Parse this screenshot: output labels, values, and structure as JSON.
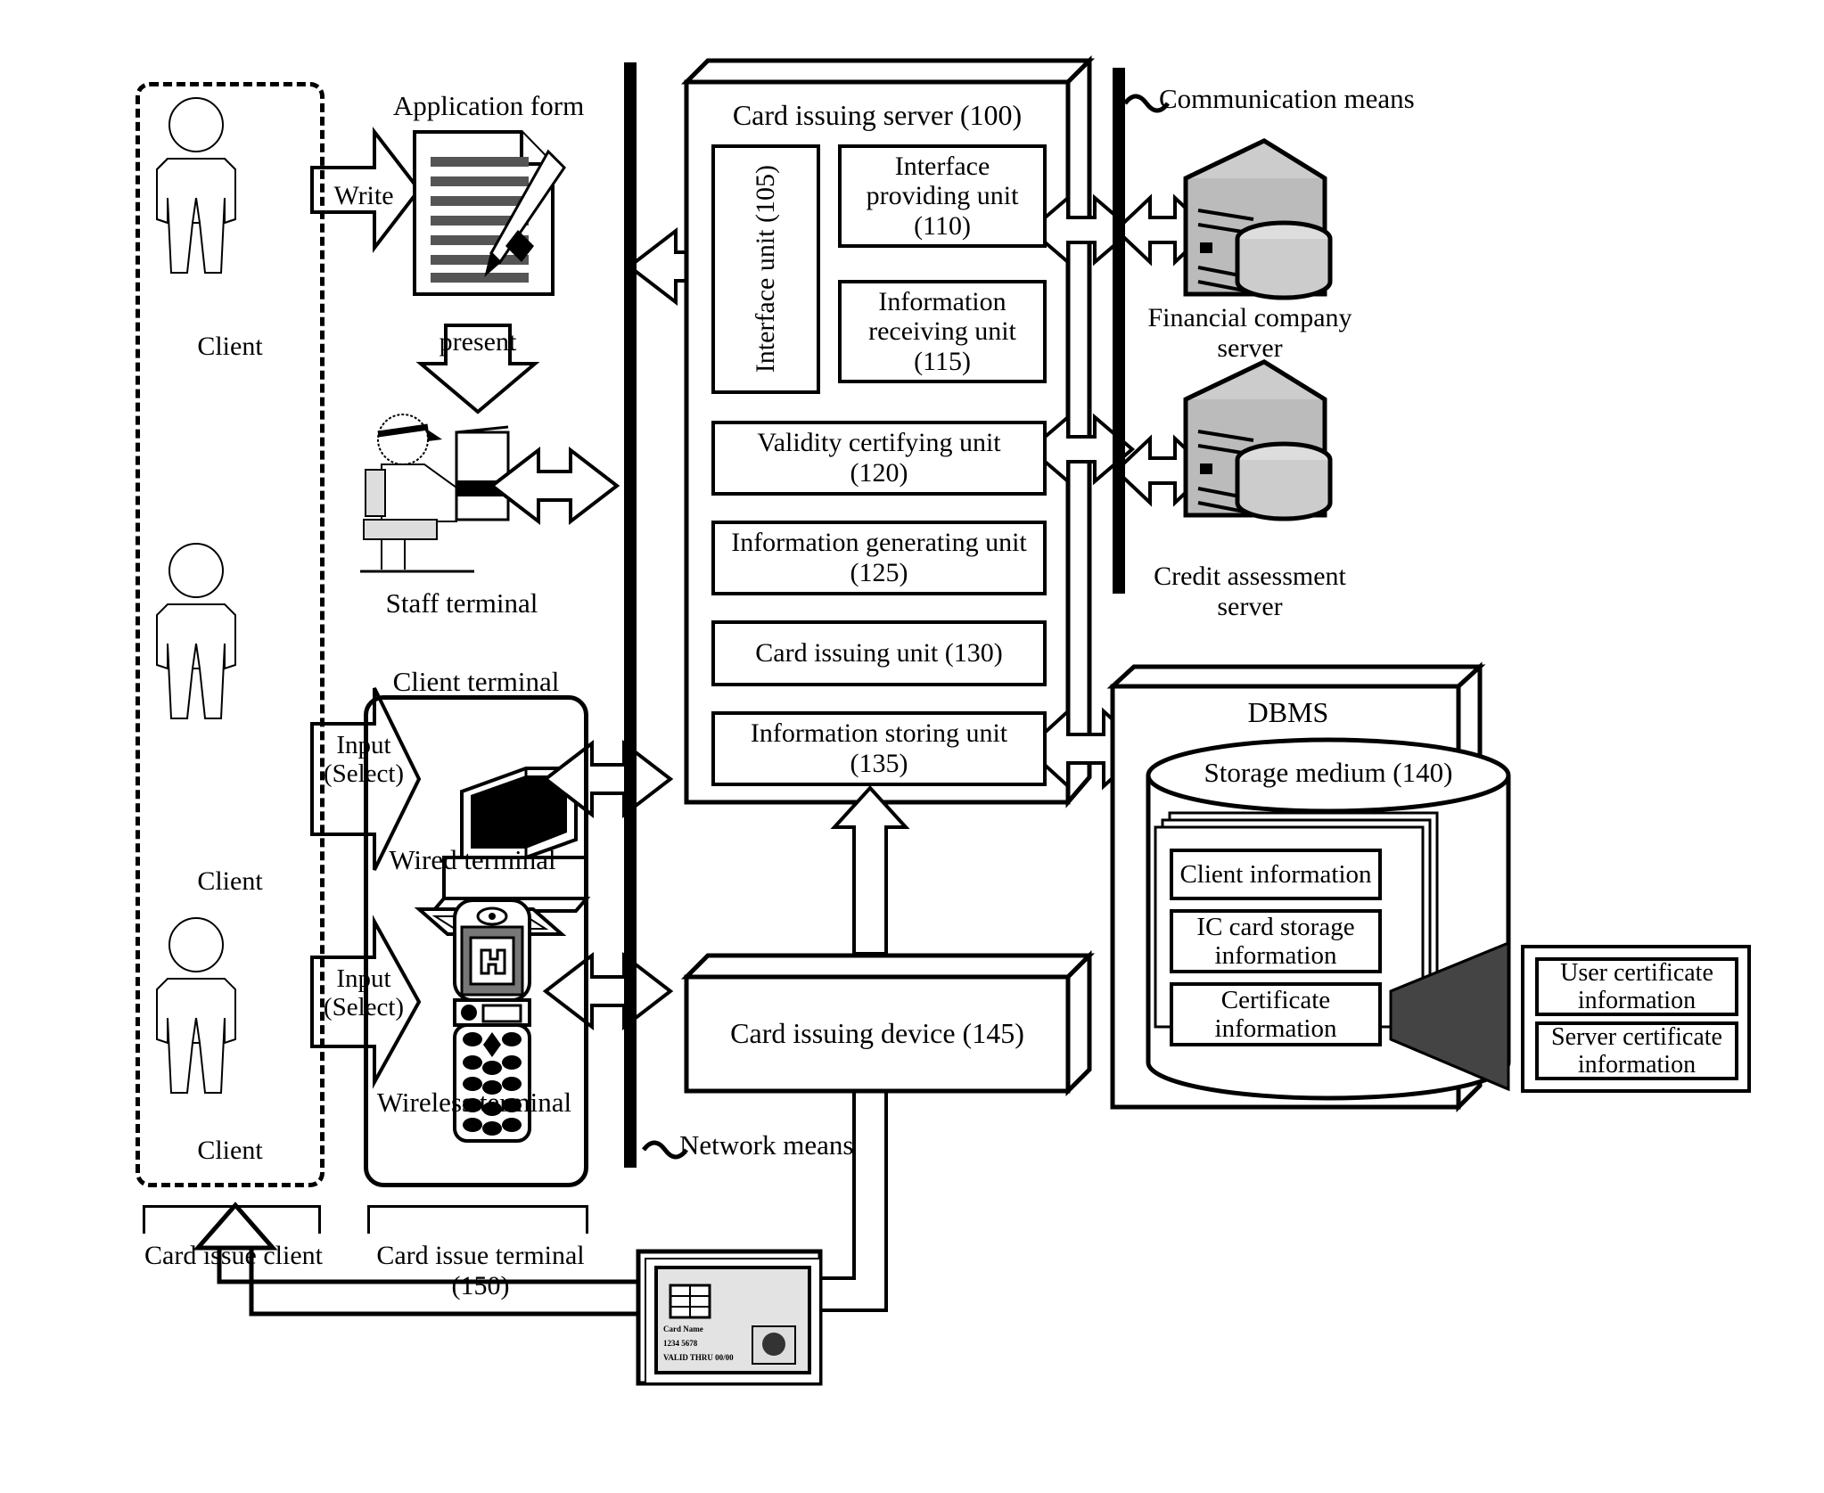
{
  "figure": {
    "type": "patent-block-diagram",
    "title": "Card issuing system block diagram"
  },
  "left": {
    "client_label_1": "Client",
    "client_label_2": "Client",
    "client_label_3": "Client",
    "application_form": "Application form",
    "write_arrow": "Write",
    "present_arrow": "present",
    "staff_terminal": "Staff terminal",
    "client_terminal": "Client terminal",
    "wired_terminal": "Wired terminal",
    "wireless_terminal": "Wireless terminal",
    "input_select_1": "Input\n(Select)",
    "input_select_2": "Input\n(Select)",
    "card_issue_client": "Card issue client",
    "card_issue_terminal": "Card issue terminal\n(150)"
  },
  "network": {
    "network_means": "Network means",
    "communication_means": "Communication means"
  },
  "server": {
    "title": "Card issuing server (100)",
    "interface_unit": "Interface unit\n(105)",
    "units": [
      {
        "label": "Interface\nproviding unit\n(110)",
        "id": "110"
      },
      {
        "label": "Information\nreceiving unit\n(115)",
        "id": "115"
      },
      {
        "label": "Validity certifying unit\n(120)",
        "id": "120"
      },
      {
        "label": "Information generating unit\n(125)",
        "id": "125"
      },
      {
        "label": "Card issuing unit (130)",
        "id": "130"
      },
      {
        "label": "Information storing unit\n(135)",
        "id": "135"
      }
    ]
  },
  "external": {
    "financial_server": "Financial company\nserver",
    "credit_server": "Credit assessment\nserver"
  },
  "dbms": {
    "title": "DBMS",
    "storage_medium": "Storage medium (140)",
    "records": [
      "Client information",
      "IC card storage\ninformation",
      "Certificate\ninformation"
    ],
    "certificates": [
      "User certificate\ninformation",
      "Server certificate\ninformation"
    ]
  },
  "device": {
    "card_issuing_device": "Card issuing device (145)"
  },
  "card": {
    "line1": "Card Name",
    "line2": "1234 5678",
    "line3": "VALID THRU 00/00"
  },
  "colors": {
    "ink": "#000000",
    "paper": "#ffffff"
  },
  "icons": {
    "person": "person-icon",
    "document": "document-icon",
    "pen": "pen-icon",
    "staff": "staff-terminal-icon",
    "desktop": "desktop-computer-icon",
    "mobile": "mobile-phone-icon",
    "server": "server-tower-icon",
    "cylinder": "database-cylinder-icon",
    "smartcard": "smart-card-icon"
  }
}
